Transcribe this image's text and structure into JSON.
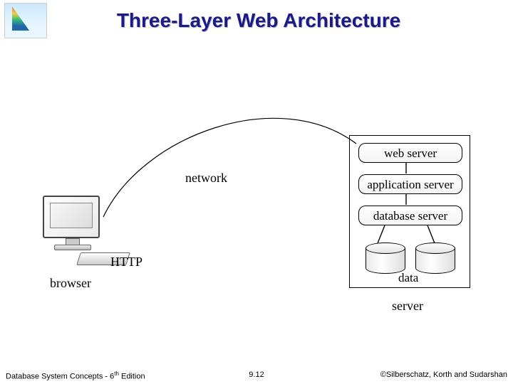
{
  "title": "Three-Layer Web Architecture",
  "diagram": {
    "client_label": "browser",
    "protocol_label": "HTTP",
    "network_label": "network",
    "server_group_label": "server",
    "data_label": "data",
    "tiers": {
      "web": "web server",
      "app": "application server",
      "db": "database server"
    }
  },
  "footer": {
    "left_prefix": "Database System Concepts - 6",
    "left_sup": "th",
    "left_suffix": " Edition",
    "center": "9.12",
    "right": "©Silberschatz, Korth and Sudarshan"
  }
}
